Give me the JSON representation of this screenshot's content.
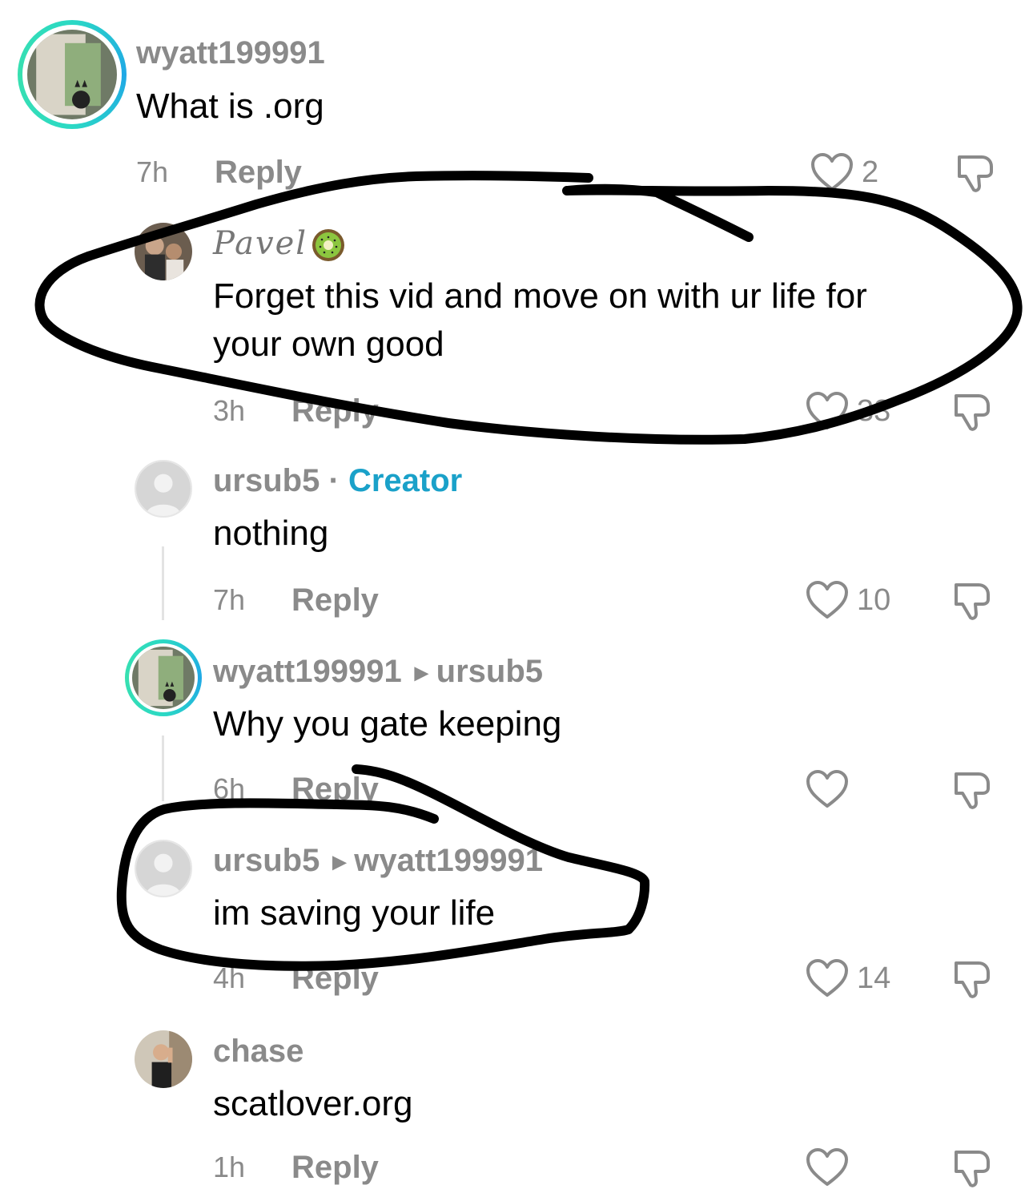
{
  "comments": [
    {
      "username": "wyatt199991",
      "text": "What is .org",
      "time": "7h",
      "reply": "Reply",
      "likes": "2"
    },
    {
      "username": "Pavel",
      "text_line1": "Forget this vid and move on with ur life for",
      "text_line2": "your own good",
      "time": "3h",
      "reply": "Reply",
      "likes": "33"
    },
    {
      "username": "ursub5",
      "separator": "·",
      "badge": "Creator",
      "text": "nothing",
      "time": "7h",
      "reply": "Reply",
      "likes": "10"
    },
    {
      "username": "wyatt199991",
      "reply_to": "ursub5",
      "text": "Why you gate keeping",
      "time": "6h",
      "reply": "Reply",
      "likes": ""
    },
    {
      "username": "ursub5",
      "reply_to": "wyatt199991",
      "text": "im saving your life",
      "time": "4h",
      "reply": "Reply",
      "likes": "14"
    },
    {
      "username": "chase",
      "text": "scatlover.org",
      "time": "1h",
      "reply": "Reply"
    }
  ],
  "icons": {
    "like": "heart-outline-icon",
    "dislike": "thumbs-down-icon",
    "reply_arrow": "triangle-right-icon",
    "emoji": "kiwi-icon"
  },
  "colors": {
    "muted": "#8a8a8a",
    "creator": "#1aa1c9",
    "ring": "#2bd9c4"
  }
}
